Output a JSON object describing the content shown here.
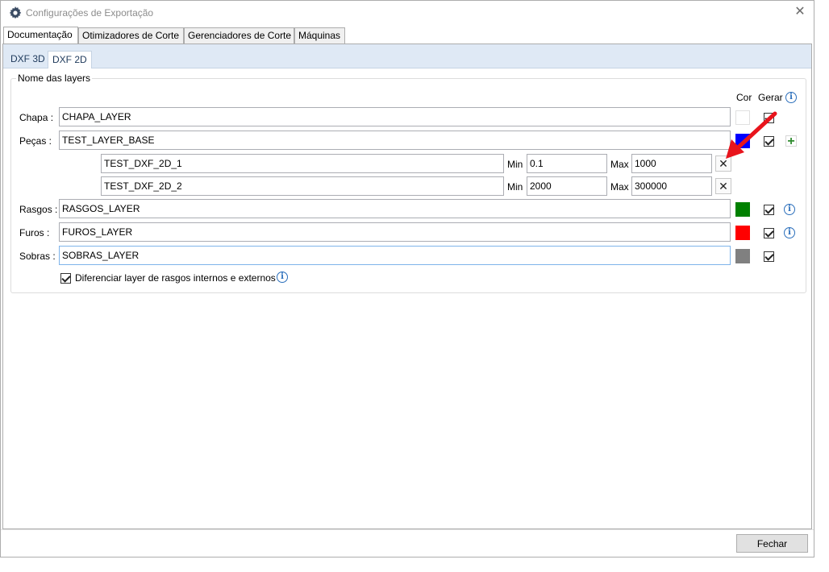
{
  "window": {
    "title": "Configurações de Exportação",
    "close_icon": "close-icon"
  },
  "tabs": [
    {
      "label": "Documentação",
      "active": true
    },
    {
      "label": "Otimizadores de Corte",
      "active": false
    },
    {
      "label": "Gerenciadores de Corte",
      "active": false
    },
    {
      "label": "Máquinas",
      "active": false
    }
  ],
  "subtabs": [
    {
      "label": "DXF 3D",
      "active": false
    },
    {
      "label": "DXF 2D",
      "active": true
    }
  ],
  "group": {
    "title": "Nome das layers",
    "col_cor": "Cor",
    "col_gerar": "Gerar",
    "chapa": {
      "label": "Chapa :",
      "value": "CHAPA_LAYER",
      "color": "#ffffff",
      "gerar": true
    },
    "pecas": {
      "label": "Peças :",
      "value": "TEST_LAYER_BASE",
      "color": "#0000ff",
      "gerar": true
    },
    "sublayers": [
      {
        "value": "TEST_DXF_2D_1",
        "min_label": "Min",
        "min": "0.1",
        "max_label": "Max",
        "max": "1000"
      },
      {
        "value": "TEST_DXF_2D_2",
        "min_label": "Min",
        "min": "2000",
        "max_label": "Max",
        "max": "300000"
      }
    ],
    "rasgos": {
      "label": "Rasgos :",
      "value": "RASGOS_LAYER",
      "color": "#008000",
      "gerar": true
    },
    "furos": {
      "label": "Furos :",
      "value": "FUROS_LAYER",
      "color": "#ff0000",
      "gerar": true
    },
    "sobras": {
      "label": "Sobras :",
      "value": "SOBRAS_LAYER",
      "color": "#808080",
      "gerar": true
    },
    "diferenciar": {
      "label": "Diferenciar layer de rasgos internos e externos",
      "checked": true
    }
  },
  "footer": {
    "fechar_label": "Fechar"
  },
  "colors": {
    "annotation_arrow": "#e8141c"
  }
}
